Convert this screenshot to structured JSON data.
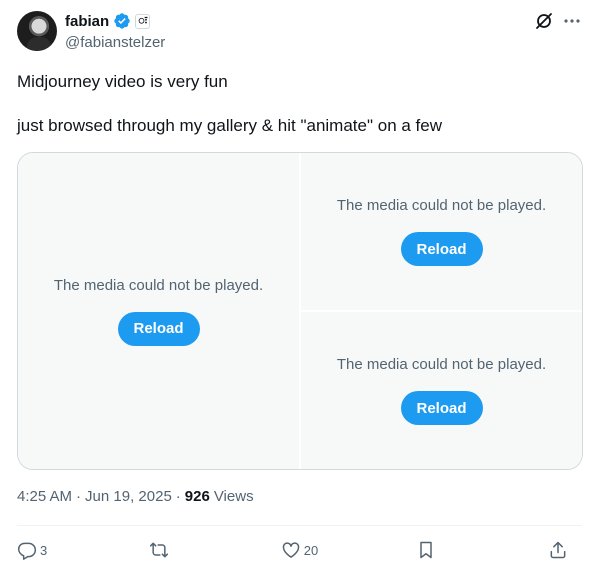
{
  "author": {
    "display_name": "fabian",
    "handle": "@fabianstelzer",
    "affiliate_badge_glyph": "ः"
  },
  "tweet": {
    "lines": [
      "Midjourney video is very fun",
      "just browsed through my gallery & hit \"animate\" on a few"
    ]
  },
  "media": {
    "tiles": [
      {
        "message": "The media could not be played.",
        "button": "Reload"
      },
      {
        "message": "The media could not be played.",
        "button": "Reload"
      },
      {
        "message": "The media could not be played.",
        "button": "Reload"
      }
    ]
  },
  "meta": {
    "time": "4:25 AM",
    "date": "Jun 19, 2025",
    "views_count": "926",
    "views_label": "Views",
    "separator": "·"
  },
  "actions": {
    "replies": "3",
    "reposts": "",
    "likes": "20"
  },
  "colors": {
    "accent": "#1d9bf0",
    "muted_text": "#536471",
    "primary_text": "#0f1419",
    "tile_bg": "#f7f9f9"
  }
}
